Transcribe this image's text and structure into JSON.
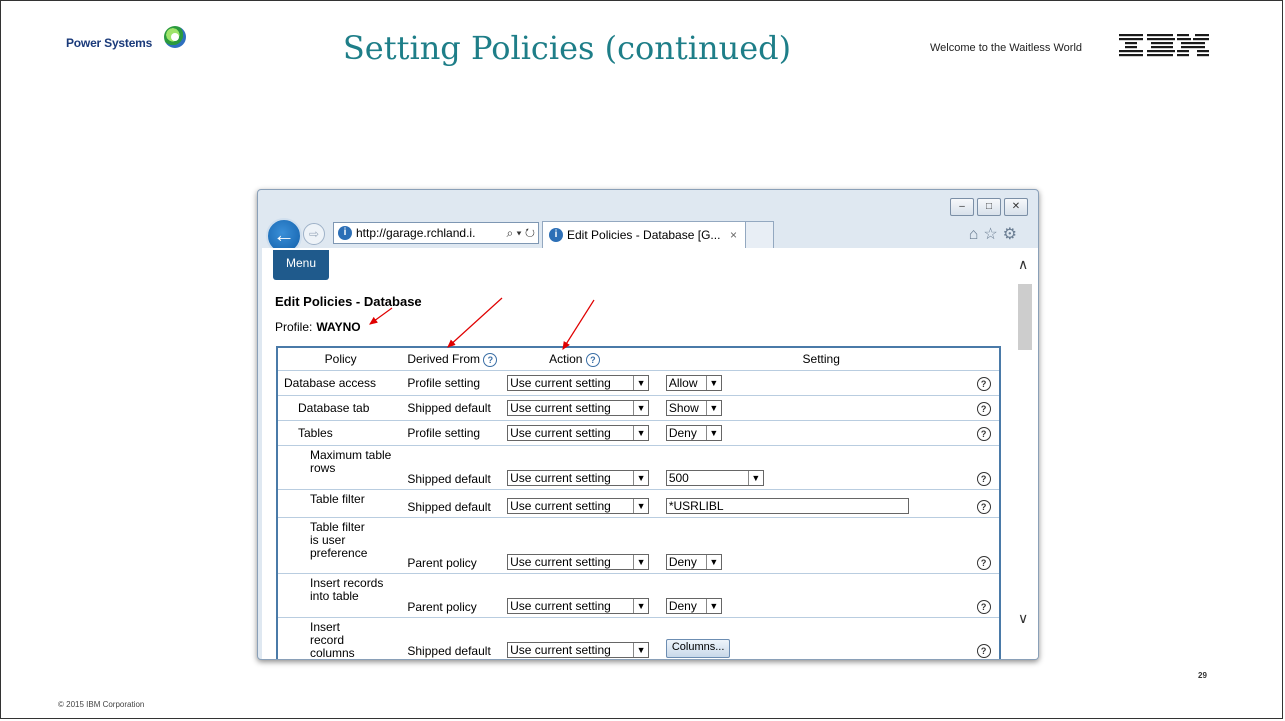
{
  "slide": {
    "brand": "Power Systems",
    "title": "Setting Policies (continued)",
    "tagline": "Welcome to the Waitless World",
    "ibm_logo": "IBM",
    "footer": "© 2015 IBM Corporation",
    "page_number": "29"
  },
  "browser": {
    "url": "http://garage.rchland.i.",
    "tab_title": "Edit Policies - Database [G...",
    "tab_close": "×",
    "window_buttons": [
      "minimize-icon",
      "maximize-icon",
      "close-icon"
    ]
  },
  "page": {
    "menu_label": "Menu",
    "title": "Edit Policies - Database",
    "profile_label": "Profile:",
    "profile_value": "WAYNO",
    "columns": {
      "policy": "Policy",
      "derived_from": "Derived From",
      "action": "Action",
      "setting": "Setting"
    },
    "rows": [
      {
        "policy": "Database access",
        "derived": "Profile setting",
        "action": "Use current setting",
        "setting": "Allow"
      },
      {
        "policy": "Database tab",
        "derived": "Shipped default",
        "action": "Use current setting",
        "setting": "Show"
      },
      {
        "policy": "Tables",
        "derived": "Profile setting",
        "action": "Use current setting",
        "setting": "Deny"
      },
      {
        "policy": "Maximum table rows",
        "derived": "Shipped default",
        "action": "Use current setting",
        "setting": "500"
      },
      {
        "policy": "Table filter",
        "derived": "Shipped default",
        "action": "Use current setting",
        "setting": "*USRLIBL"
      },
      {
        "policy": "Table filter is user preference",
        "derived": "Parent policy",
        "action": "Use current setting",
        "setting": "Deny"
      },
      {
        "policy": "Insert records into table",
        "derived": "Parent policy",
        "action": "Use current setting",
        "setting": "Deny"
      },
      {
        "policy": "Insert record columns",
        "derived": "Shipped default",
        "action": "Use current setting",
        "setting": "Columns..."
      }
    ]
  },
  "colors": {
    "title_teal": "#1e7e88",
    "menu_blue": "#1f5a8c",
    "table_border": "#4a7aa8",
    "annotation_red": "#e00000"
  }
}
